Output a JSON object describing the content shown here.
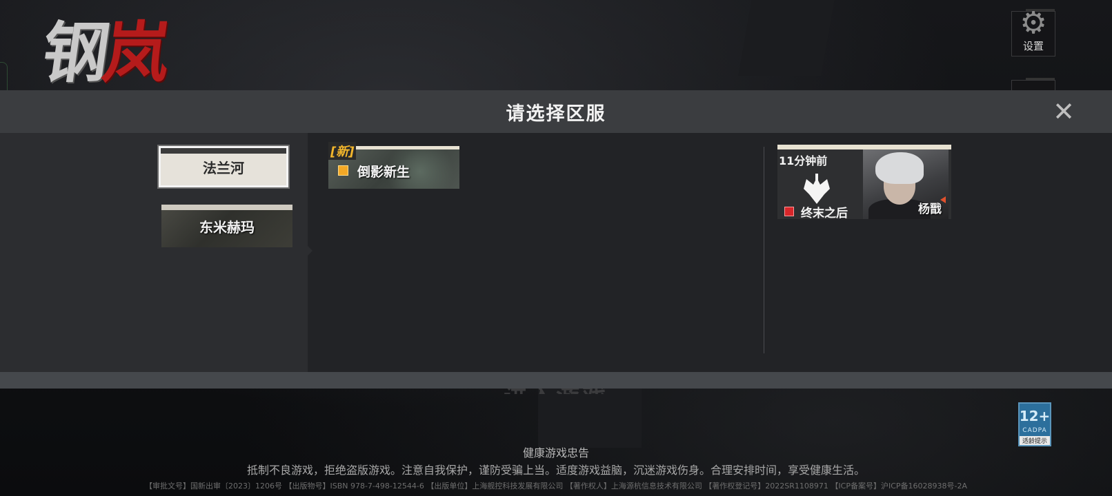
{
  "background": {
    "logo_part1": "钢",
    "logo_part2": "岚",
    "settings_label": "设置",
    "enter_game": "进入游戏",
    "health_notice_title": "健康游戏忠告",
    "health_notice_body": "抵制不良游戏，拒绝盗版游戏。注意自我保护，谨防受骗上当。适度游戏益脑，沉迷游戏伤身。合理安排时间，享受健康生活。",
    "legal_text": "【审批文号】国新出审〔2023〕1206号 【出版物号】ISBN 978-7-498-12544-6 【出版单位】上海舰控科技发展有限公司 【著作权人】上海源杭信息技术有限公司 【著作权登记号】2022SR1108971 【ICP备案号】沪ICP备16028938号-2A",
    "age_rating": {
      "label": "12+",
      "org": "CADPA",
      "tip": "适龄提示"
    }
  },
  "dialog": {
    "title": "请选择区服",
    "close_icon": "close-icon",
    "regions": [
      {
        "label": "法兰河",
        "selected": true
      },
      {
        "label": "东米赫玛",
        "selected": false
      }
    ],
    "servers": [
      {
        "tag": "[新]",
        "name": "倒影新生",
        "status_color": "#f3a826"
      }
    ],
    "recent": {
      "time": "11分钟前",
      "server_name": "终末之后",
      "character_name": "杨戬",
      "status_color": "#d8262a"
    }
  },
  "colors": {
    "header_bg": "#3b3d40",
    "body_bg": "#2c2d30",
    "list_bg": "#222326",
    "new_tag": "#f3b62c"
  }
}
